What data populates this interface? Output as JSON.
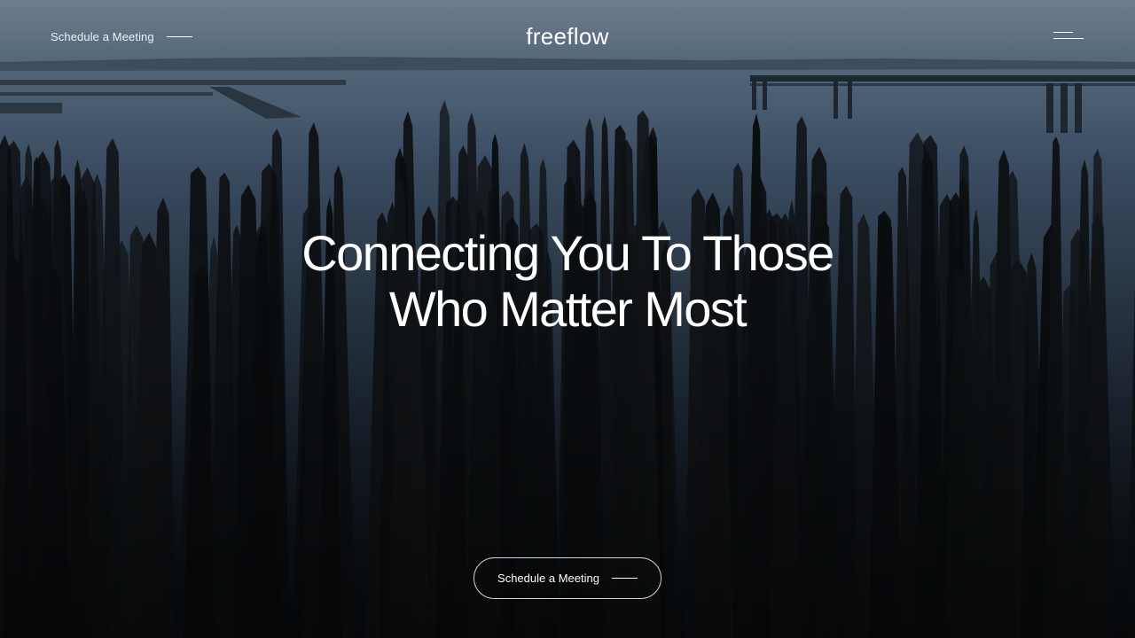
{
  "header": {
    "schedule_link": "Schedule a Meeting",
    "logo": "freeflow",
    "menu_icon": "hamburger-menu-icon"
  },
  "hero": {
    "headline_line1": "Connecting You To Those",
    "headline_line2": "Who Matter Most",
    "cta_label": "Schedule a Meeting",
    "background": "aerial photo of old wooden pier pilings in calm water at dusk"
  },
  "colors": {
    "text": "#ffffff",
    "sky": "#6d7f90",
    "water": "#3a4d60",
    "shadow": "#0a0d10"
  }
}
